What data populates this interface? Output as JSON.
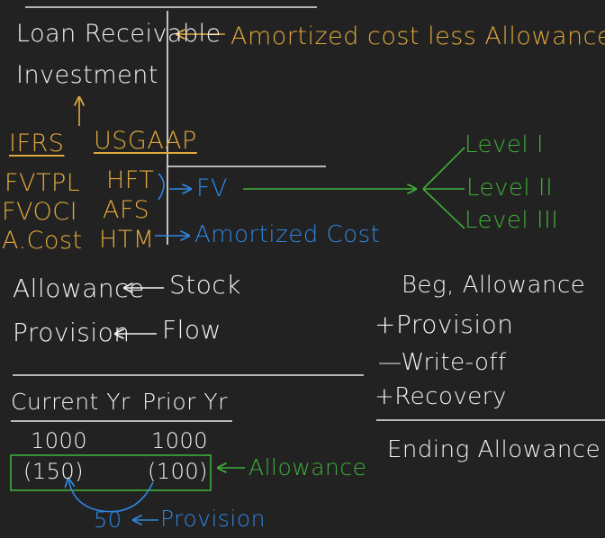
{
  "colors": {
    "background": "#222222",
    "chalk_white": "#f2f2f2",
    "yellow": "#e1a83b",
    "green": "#3fae3a",
    "blue": "#2f86e0"
  },
  "top_section": {
    "loan_receivable": "Loan Receivable",
    "amortized_note": "Amortized cost less Allowance",
    "investment": "Investment",
    "ifrs": {
      "header": "IFRS",
      "items": [
        "FVTPL",
        "FVOCI",
        "A.Cost"
      ]
    },
    "usgaap": {
      "header": "USGAAP",
      "items": [
        "HFT",
        "AFS",
        "HTM"
      ]
    },
    "fv": "FV",
    "amortized_cost": "Amortized Cost",
    "levels": [
      "Level I",
      "Level II",
      "Level III"
    ]
  },
  "definitions": {
    "allowance": "Allowance",
    "stock": "Stock",
    "provision": "Provision",
    "flow": "Flow"
  },
  "rollforward": {
    "beg": "Beg, Allowance",
    "provision": "+Provision",
    "writeoff": "—Write-off",
    "recovery": "+Recovery",
    "ending": "Ending Allowance"
  },
  "comparison": {
    "current_header": "Current Yr",
    "prior_header": "Prior Yr",
    "current_gross": "1000",
    "prior_gross": "1000",
    "current_allowance": "(150)",
    "prior_allowance": "(100)",
    "allowance_label": "Allowance",
    "provision_amount": "50",
    "provision_label": "Provision"
  }
}
